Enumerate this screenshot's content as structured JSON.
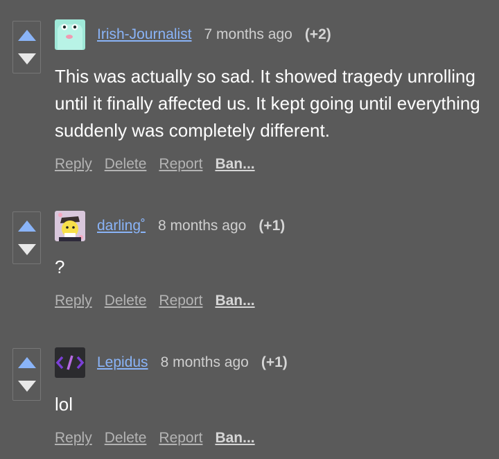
{
  "comments": [
    {
      "username": "Irish-Journalist",
      "time": "7 months ago",
      "score": "(+2)",
      "text": "This was actually so sad. It showed tragedy unrolling until it finally affected us. It kept going until everything suddenly was completely different.",
      "avatar_icon": "frog-avatar"
    },
    {
      "username": "darling˚",
      "time": "8 months ago",
      "score": "(+1)",
      "text": "?",
      "avatar_icon": "anime-character-avatar"
    },
    {
      "username": "Lepidus",
      "time": "8 months ago",
      "score": "(+1)",
      "text": "lol",
      "avatar_icon": "code-brackets-avatar"
    }
  ],
  "actions": {
    "reply": "Reply",
    "delete": "Delete",
    "report": "Report",
    "ban": "Ban..."
  },
  "colors": {
    "background": "#5a5a5a",
    "username": "#8ab4f8",
    "upvote_arrow": "#8ab4f8",
    "downvote_arrow": "#e8e8e8"
  }
}
